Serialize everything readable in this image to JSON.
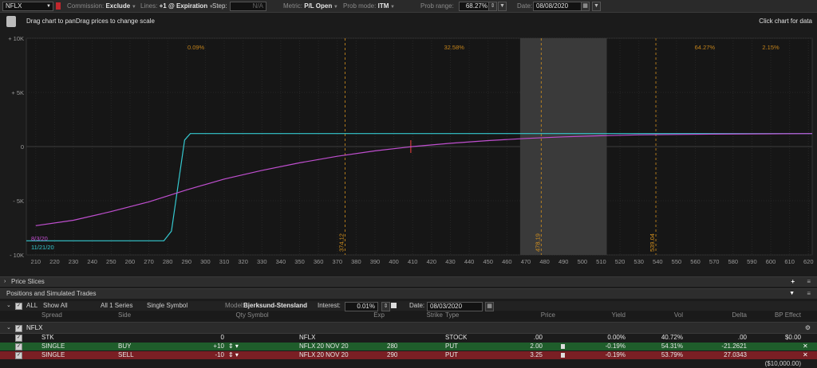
{
  "toolbar": {
    "symbol": "NFLX",
    "commission_label": "Commission:",
    "commission_value": "Exclude",
    "lines_label": "Lines:",
    "lines_value": "+1 @ Expiration",
    "step_label": "Step:",
    "step_value": "N/A",
    "metric_label": "Metric:",
    "metric_value": "P/L Open",
    "prob_mode_label": "Prob mode:",
    "prob_mode_value": "ITM",
    "prob_range_label": "Prob range:",
    "prob_range_value": "68.27%",
    "date_label": "Date:",
    "date_value": "08/08/2020"
  },
  "hint": {
    "left": "Drag chart to panDrag prices to change scale",
    "right": "Click chart for data"
  },
  "chart_data": {
    "type": "line",
    "xlim": [
      205,
      622
    ],
    "ylim": [
      -10000,
      10000
    ],
    "x_ticks": [
      210,
      220,
      230,
      240,
      250,
      260,
      270,
      280,
      290,
      300,
      310,
      320,
      330,
      340,
      350,
      360,
      370,
      380,
      390,
      400,
      410,
      420,
      430,
      440,
      450,
      460,
      470,
      480,
      490,
      500,
      510,
      520,
      530,
      540,
      550,
      560,
      570,
      580,
      590,
      600,
      610,
      620
    ],
    "y_ticks": [
      {
        "v": 10000,
        "label": "+ 10K"
      },
      {
        "v": 5000,
        "label": "+ 5K"
      },
      {
        "v": 0,
        "label": "0"
      },
      {
        "v": -5000,
        "label": "- 5K"
      },
      {
        "v": -10000,
        "label": "- 10K"
      }
    ],
    "prob_labels": [
      {
        "x": 295,
        "text": "0.09%"
      },
      {
        "x": 432,
        "text": "32.58%"
      },
      {
        "x": 565,
        "text": "64.27%"
      },
      {
        "x": 600,
        "text": "2.15%"
      }
    ],
    "markers": [
      {
        "x": 374.12,
        "label": "374.12"
      },
      {
        "x": 478.19,
        "label": "478.19"
      },
      {
        "x": 539.04,
        "label": "539.04"
      }
    ],
    "shaded_range": [
      467,
      513
    ],
    "current_price": 409,
    "series": [
      {
        "name": "11/21/20",
        "color": "#35c8cf",
        "points": [
          [
            205,
            -8700
          ],
          [
            278,
            -8700
          ],
          [
            282,
            -7800
          ],
          [
            286,
            -3000
          ],
          [
            289,
            600
          ],
          [
            292,
            1200
          ],
          [
            622,
            1200
          ]
        ]
      },
      {
        "name": "8/3/20",
        "color": "#c04fd0",
        "points": [
          [
            210,
            -7300
          ],
          [
            230,
            -6800
          ],
          [
            250,
            -6000
          ],
          [
            270,
            -5100
          ],
          [
            290,
            -4000
          ],
          [
            310,
            -3000
          ],
          [
            330,
            -2200
          ],
          [
            350,
            -1500
          ],
          [
            370,
            -900
          ],
          [
            390,
            -400
          ],
          [
            410,
            0
          ],
          [
            430,
            300
          ],
          [
            450,
            550
          ],
          [
            470,
            750
          ],
          [
            490,
            900
          ],
          [
            510,
            1000
          ],
          [
            530,
            1080
          ],
          [
            550,
            1120
          ],
          [
            570,
            1150
          ],
          [
            600,
            1180
          ],
          [
            622,
            1200
          ]
        ]
      }
    ]
  },
  "price_slices": {
    "label": "Price Slices"
  },
  "positions": {
    "title": "Positions and Simulated Trades",
    "filter": {
      "all_label": "ALL",
      "show_all": "Show All",
      "series": "All 1 Series",
      "symbol_mode": "Single Symbol",
      "model_label": "Model:",
      "model_value": "Bjerksund-Stensland",
      "interest_label": "Interest:",
      "interest_value": "0.01%",
      "date_label": "Date:",
      "date_value": "08/03/2020"
    },
    "columns": {
      "spread": "Spread",
      "side": "Side",
      "qty": "Qty",
      "symbol": "Symbol",
      "exp": "Exp",
      "strike": "Strike",
      "type": "Type",
      "price": "Price",
      "yield": "Yield",
      "vol": "Vol",
      "delta": "Delta",
      "bp": "BP Effect"
    },
    "group": {
      "symbol": "NFLX"
    },
    "rows": [
      {
        "spread": "STK",
        "side": "",
        "qty": "0",
        "symbol": "NFLX",
        "exp": "",
        "strike": "",
        "type": "STOCK",
        "price": ".00",
        "yield": "0.00%",
        "vol": "40.72%",
        "delta": ".00",
        "bp": "$0.00",
        "color": "#1b1b1b"
      },
      {
        "spread": "SINGLE",
        "side": "BUY",
        "qty": "+10",
        "symbol": "NFLX",
        "exp": "20 NOV 20",
        "strike": "280",
        "type": "PUT",
        "price": "2.00",
        "yield": "-0.19%",
        "vol": "54.31%",
        "delta": "-21.2621",
        "bp": "",
        "color": "#1f5d2b"
      },
      {
        "spread": "SINGLE",
        "side": "SELL",
        "qty": "-10",
        "symbol": "NFLX",
        "exp": "20 NOV 20",
        "strike": "290",
        "type": "PUT",
        "price": "3.25",
        "yield": "-0.19%",
        "vol": "53.79%",
        "delta": "27.0343",
        "bp": "",
        "color": "#7a1f24"
      }
    ],
    "total_bp": "($10,000.00)"
  },
  "colors": {
    "profit_line": "#35c8cf",
    "theo_line": "#c04fd0",
    "marker": "#d4911f",
    "buy_row": "#1f5d2b",
    "sell_row": "#7a1f24"
  }
}
